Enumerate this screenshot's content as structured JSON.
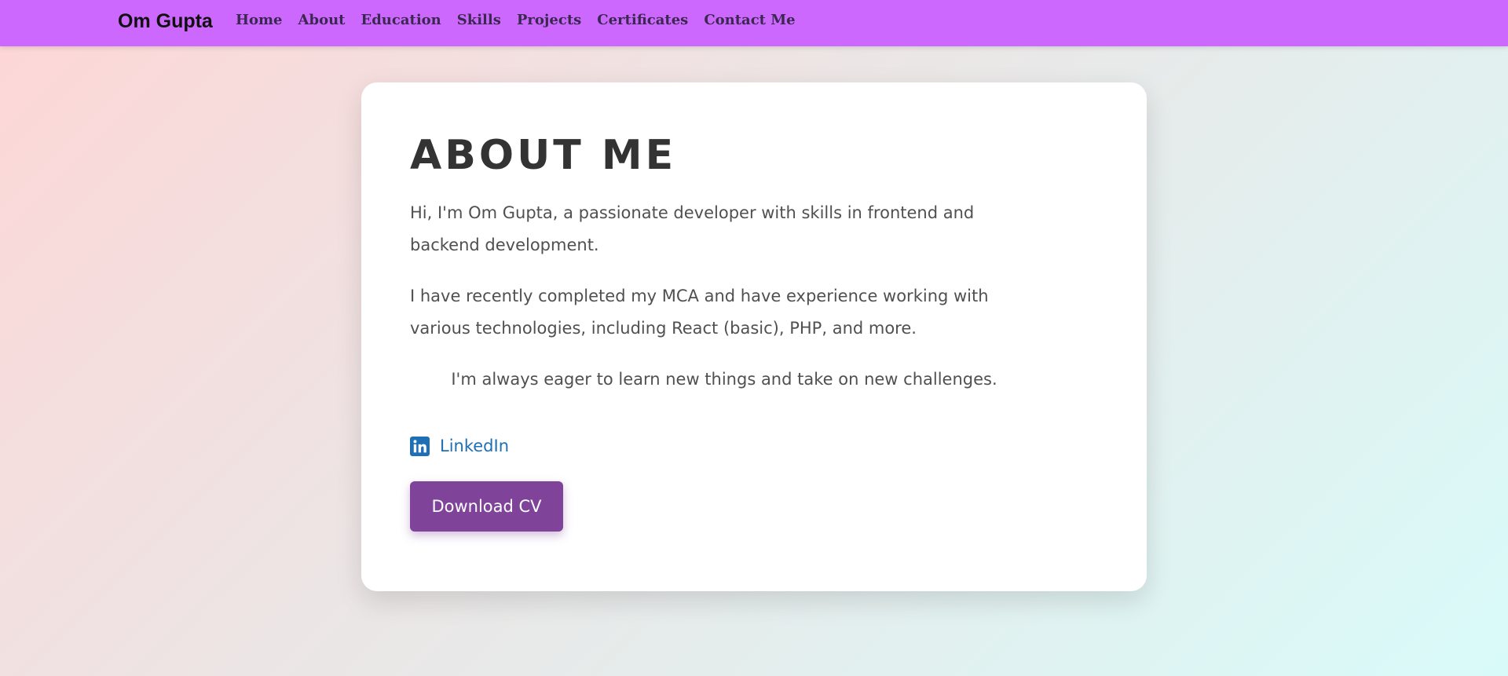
{
  "navbar": {
    "brand": "Om Gupta",
    "links": [
      "Home",
      "About",
      "Education",
      "Skills",
      "Projects",
      "Certificates",
      "Contact Me"
    ]
  },
  "about": {
    "title": "ABOUT ME",
    "paragraphs": [
      "Hi, I'm Om Gupta, a passionate developer with skills in frontend and backend development.",
      "I have recently completed my MCA and have experience working with various technologies, including React (basic), PHP, and more.",
      "I'm always eager to learn new things and take on new challenges."
    ],
    "linkedin": {
      "label": "LinkedIn",
      "icon": "linkedin-icon"
    },
    "download_label": "Download CV"
  },
  "colors": {
    "navbar_bg": "#cd68ff",
    "button_bg": "#7f449a",
    "link": "#1f6fb5"
  }
}
